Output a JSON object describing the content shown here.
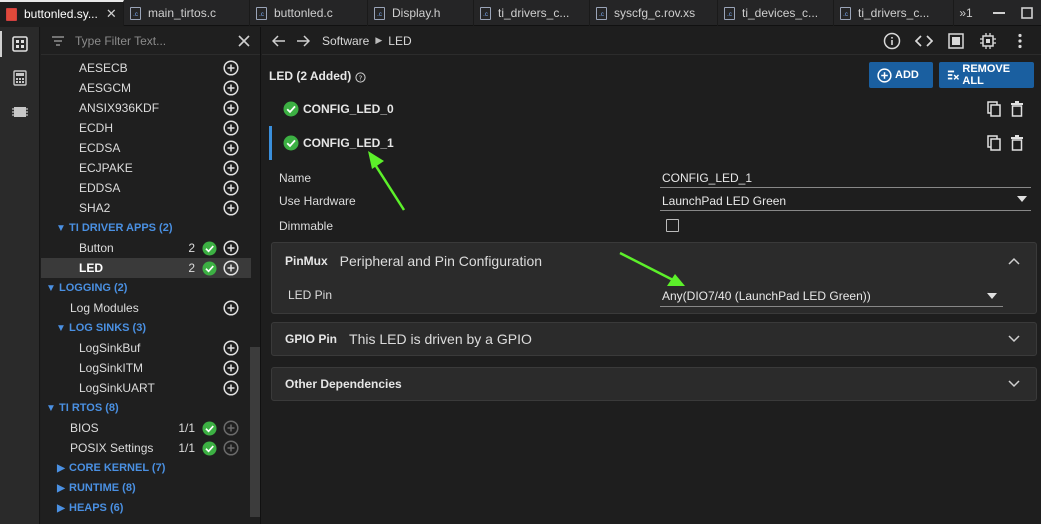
{
  "tabs": [
    {
      "label": "buttonled.sy...",
      "active": true,
      "closable": true,
      "icon": "syscfg-file-icon"
    },
    {
      "label": "main_tirtos.c"
    },
    {
      "label": "buttonled.c"
    },
    {
      "label": "Display.h"
    },
    {
      "label": "ti_drivers_c..."
    },
    {
      "label": "syscfg_c.rov.xs"
    },
    {
      "label": "ti_devices_c..."
    },
    {
      "label": "ti_drivers_c..."
    }
  ],
  "tab_overflow": "»1",
  "filter": {
    "placeholder": "Type Filter Text..."
  },
  "tree": [
    {
      "label": "AESECB",
      "indent": 38
    },
    {
      "label": "AESGCM",
      "indent": 38
    },
    {
      "label": "ANSIX936KDF",
      "indent": 38
    },
    {
      "label": "ECDH",
      "indent": 38
    },
    {
      "label": "ECDSA",
      "indent": 38
    },
    {
      "label": "ECJPAKE",
      "indent": 38
    },
    {
      "label": "EDDSA",
      "indent": 38
    },
    {
      "label": "SHA2",
      "indent": 38
    },
    {
      "label": "TI DRIVER APPS (2)",
      "indent": 14,
      "category": true,
      "open": true
    },
    {
      "label": "Button",
      "indent": 38,
      "count": "2",
      "ok": true
    },
    {
      "label": "LED",
      "indent": 38,
      "count": "2",
      "ok": true,
      "selected": true
    },
    {
      "label": "LOGGING (2)",
      "indent": 4,
      "category": true,
      "open": true
    },
    {
      "label": "Log Modules",
      "indent": 29
    },
    {
      "label": "LOG SINKS (3)",
      "indent": 14,
      "category": true,
      "open": true
    },
    {
      "label": "LogSinkBuf",
      "indent": 38
    },
    {
      "label": "LogSinkITM",
      "indent": 38
    },
    {
      "label": "LogSinkUART",
      "indent": 38
    },
    {
      "label": "TI RTOS (8)",
      "indent": 4,
      "category": true,
      "open": true
    },
    {
      "label": "BIOS",
      "indent": 29,
      "count": "1/1",
      "ok": true,
      "disabled_add": true
    },
    {
      "label": "POSIX Settings",
      "indent": 29,
      "count": "1/1",
      "ok": true,
      "disabled_add": true
    },
    {
      "label": "CORE KERNEL (7)",
      "indent": 14,
      "category": true,
      "open": false
    },
    {
      "label": "RUNTIME (8)",
      "indent": 14,
      "category": true,
      "open": false
    },
    {
      "label": "HEAPS (6)",
      "indent": 14,
      "category": true,
      "open": false
    }
  ],
  "breadcrumb": [
    "Software",
    "LED"
  ],
  "header": {
    "title": "LED (2 Added)",
    "add_label": "ADD",
    "remove_all_label": "REMOVE ALL"
  },
  "instances": [
    {
      "label": "CONFIG_LED_0"
    },
    {
      "label": "CONFIG_LED_1"
    }
  ],
  "properties": {
    "name": {
      "label": "Name",
      "value": "CONFIG_LED_1"
    },
    "hardware": {
      "label": "Use Hardware",
      "value": "LaunchPad LED Green"
    },
    "dimmable": {
      "label": "Dimmable"
    }
  },
  "panels": {
    "pinmux": {
      "title": "PinMux",
      "subtitle": "Peripheral and Pin Configuration",
      "led_pin_label": "LED Pin",
      "led_pin_value": "Any(DIO7/40 (LaunchPad LED Green))"
    },
    "gpio": {
      "title": "GPIO Pin",
      "subtitle": "This LED is driven by a GPIO"
    },
    "deps": {
      "title": "Other Dependencies"
    }
  },
  "colors": {
    "accent": "#1a5fa0",
    "ok_green": "#3cb043",
    "category_blue": "#4a90e2",
    "annotation_arrow": "#5cf02a"
  }
}
